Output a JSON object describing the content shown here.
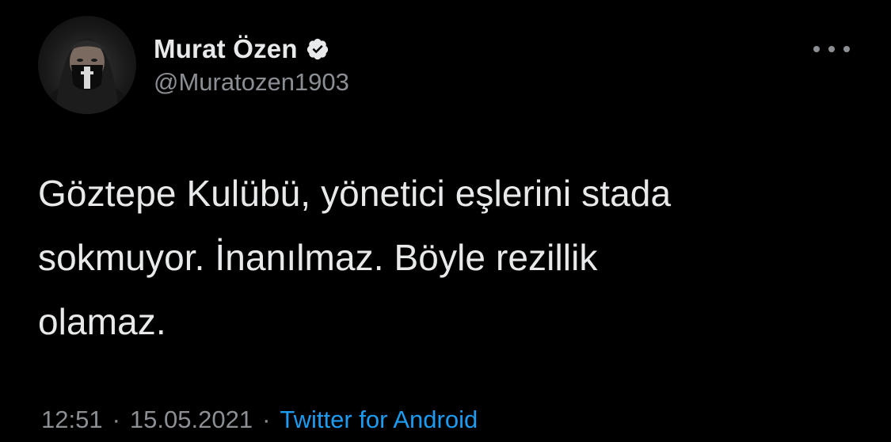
{
  "author": {
    "display_name": "Murat Özen",
    "handle": "@Muratozen1903",
    "verified": true
  },
  "tweet": {
    "text": "Göztepe Kulübü, yönetici eşlerini stada\nsokmuyor. İnanılmaz. Böyle rezillik\nolamaz.",
    "time": "12:51",
    "date": "15.05.2021",
    "separator": "·",
    "source": "Twitter for Android"
  },
  "icons": {
    "verified": "verified-badge-icon",
    "more": "more-options-icon",
    "avatar": "user-avatar"
  },
  "colors": {
    "background": "#000000",
    "text_primary": "#e7e9ea",
    "text_secondary": "#8b8f94",
    "link": "#1d9bf0",
    "verified_badge": "#e7e9ea"
  }
}
